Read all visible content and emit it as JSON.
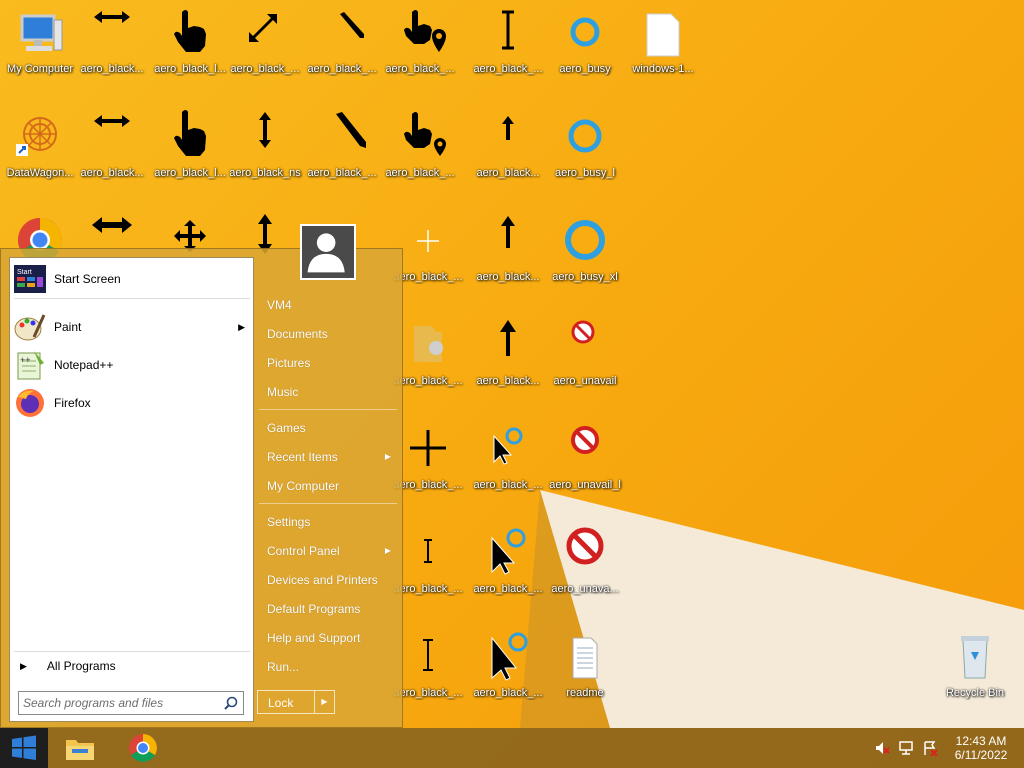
{
  "desktop": {
    "icons": [
      {
        "label": "My Computer"
      },
      {
        "label": "aero_black..."
      },
      {
        "label": "aero_black_l..."
      },
      {
        "label": "aero_black_..."
      },
      {
        "label": "aero_black_..."
      },
      {
        "label": "aero_black_..."
      },
      {
        "label": "aero_black_..."
      },
      {
        "label": "aero_busy"
      },
      {
        "label": "windows-1..."
      },
      {
        "label": "DataWagon..."
      },
      {
        "label": "aero_black..."
      },
      {
        "label": "aero_black_l..."
      },
      {
        "label": "aero_black_ns"
      },
      {
        "label": "aero_black_..."
      },
      {
        "label": "aero_black_..."
      },
      {
        "label": "aero_black..."
      },
      {
        "label": "aero_busy_l"
      },
      {
        "label": "aero_black_..."
      },
      {
        "label": "aero_black..."
      },
      {
        "label": "aero_busy_xl"
      },
      {
        "label": "aero_black_..."
      },
      {
        "label": "aero_black..."
      },
      {
        "label": "aero_unavail"
      },
      {
        "label": "aero_black_..."
      },
      {
        "label": "aero_black_..."
      },
      {
        "label": "aero_unavail_l"
      },
      {
        "label": "aero_black_..."
      },
      {
        "label": "aero_black_..."
      },
      {
        "label": "aero_unava..."
      },
      {
        "label": "aero_black_..."
      },
      {
        "label": "aero_black_..."
      },
      {
        "label": "readme"
      },
      {
        "label": "Recycle Bin"
      }
    ]
  },
  "start_menu": {
    "pinned": [
      {
        "label": "Start Screen",
        "icon": "start-screen-icon"
      },
      {
        "label": "Paint",
        "icon": "paint-icon"
      },
      {
        "label": "Notepad++",
        "icon": "notepad-plus-plus-icon"
      },
      {
        "label": "Firefox",
        "icon": "firefox-icon"
      }
    ],
    "all_programs": "All Programs",
    "search_placeholder": "Search programs and files",
    "right_items": [
      {
        "label": "VM4"
      },
      {
        "label": "Documents"
      },
      {
        "label": "Pictures"
      },
      {
        "label": "Music"
      },
      {
        "label": "Games"
      },
      {
        "label": "Recent Items"
      },
      {
        "label": "My Computer"
      },
      {
        "label": "Settings"
      },
      {
        "label": "Control Panel"
      },
      {
        "label": "Devices and Printers"
      },
      {
        "label": "Default Programs"
      },
      {
        "label": "Help and Support"
      },
      {
        "label": "Run..."
      }
    ],
    "lock_label": "Lock"
  },
  "taskbar": {
    "pinned_icons": [
      "file-explorer-icon",
      "chrome-icon"
    ],
    "tray_icons": [
      "volume-muted-icon",
      "network-icon",
      "action-center-flag-icon"
    ],
    "time": "12:43 AM",
    "date": "6/11/2022"
  },
  "colors": {
    "wallpaper": "#f7a90f",
    "start_menu_glass": "#daa534",
    "taskbar": "#825f1e"
  }
}
